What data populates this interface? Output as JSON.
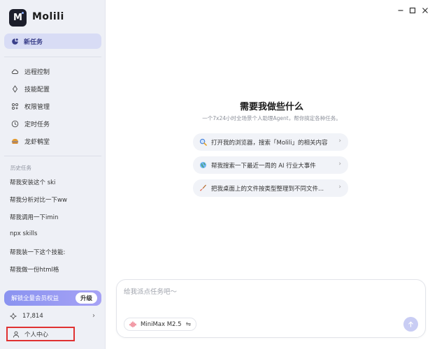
{
  "app": {
    "name": "Molili",
    "logo_letter": "M"
  },
  "sidebar": {
    "new_task": "新任务",
    "nav": [
      {
        "label": "远程控制",
        "icon": "cloud-icon"
      },
      {
        "label": "技能配置",
        "icon": "diamond-icon"
      },
      {
        "label": "权限管理",
        "icon": "grid-icon"
      },
      {
        "label": "定时任务",
        "icon": "clock-icon"
      },
      {
        "label": "龙虾鹌堂",
        "icon": "burger-icon"
      }
    ],
    "history_label": "历史任务",
    "history": [
      "帮我安装这个 ski",
      "帮我分析对比一下ww",
      "帮我调用一下imin",
      "npx skills",
      "帮我装一下这个技能:",
      "帮我做一份html格"
    ],
    "vip": {
      "label": "解锁全量会员权益",
      "upgrade": "升级"
    },
    "credits": "17,814",
    "profile": "个人中心"
  },
  "main": {
    "title": "需要我做些什么",
    "subtitle": "一个7x24小时全场景个人助理Agent，帮你搞定各种任务。",
    "suggestions": [
      {
        "text": "打开我的浏览器，搜索「Molili」的相关内容",
        "icon": "search-icon"
      },
      {
        "text": "帮我搜索一下最近一周的 AI 行业大事件",
        "icon": "globe-icon"
      },
      {
        "text": "把我桌面上的文件按类型整理到不同文件...",
        "icon": "broom-icon"
      }
    ]
  },
  "composer": {
    "placeholder": "给我派点任务吧～",
    "model": "MiniMax M2.5"
  },
  "colors": {
    "accent": "#d8dcf5",
    "vip_gradient_start": "#8a93f0",
    "highlight_border": "#e03131",
    "send_button": "#c9cdf4"
  }
}
